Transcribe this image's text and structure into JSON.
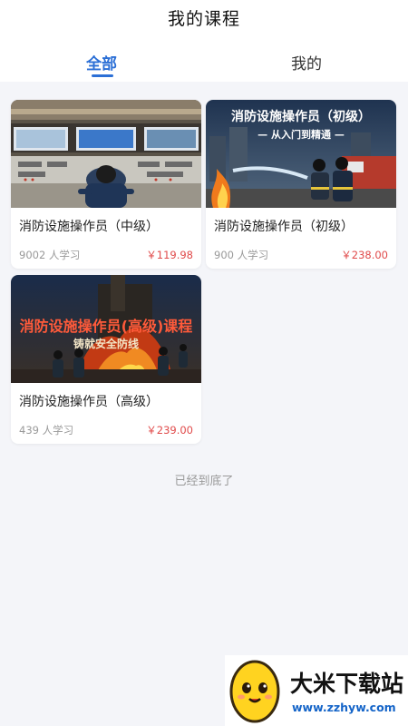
{
  "header": {
    "title": "我的课程"
  },
  "tabs": [
    {
      "label": "全部",
      "active": true
    },
    {
      "label": "我的",
      "active": false
    }
  ],
  "courses": [
    {
      "title": "消防设施操作员（中级）",
      "learners": "9002 人学习",
      "price": "￥119.98",
      "thumb_icon": "control-room-image"
    },
    {
      "title": "消防设施操作员（初级）",
      "learners": "900 人学习",
      "price": "￥238.00",
      "thumb_icon": "firefighters-image",
      "banner_title": "消防设施操作员（初级）",
      "banner_subtitle": "— 从入门到精通 —"
    },
    {
      "title": "消防设施操作员（高级）",
      "learners": "439 人学习",
      "price": "￥239.00",
      "thumb_icon": "fire-scene-image",
      "banner_title": "消防设施操作员(高级)课程",
      "banner_subtitle": "铸就安全防线"
    }
  ],
  "footer": {
    "end_text": "已经到底了"
  },
  "watermark": {
    "name": "大米下载站",
    "url": "www.zzhyw.com"
  },
  "colors": {
    "accent": "#2b6fd6",
    "price": "#e04a4a",
    "background": "#f4f5f9"
  }
}
